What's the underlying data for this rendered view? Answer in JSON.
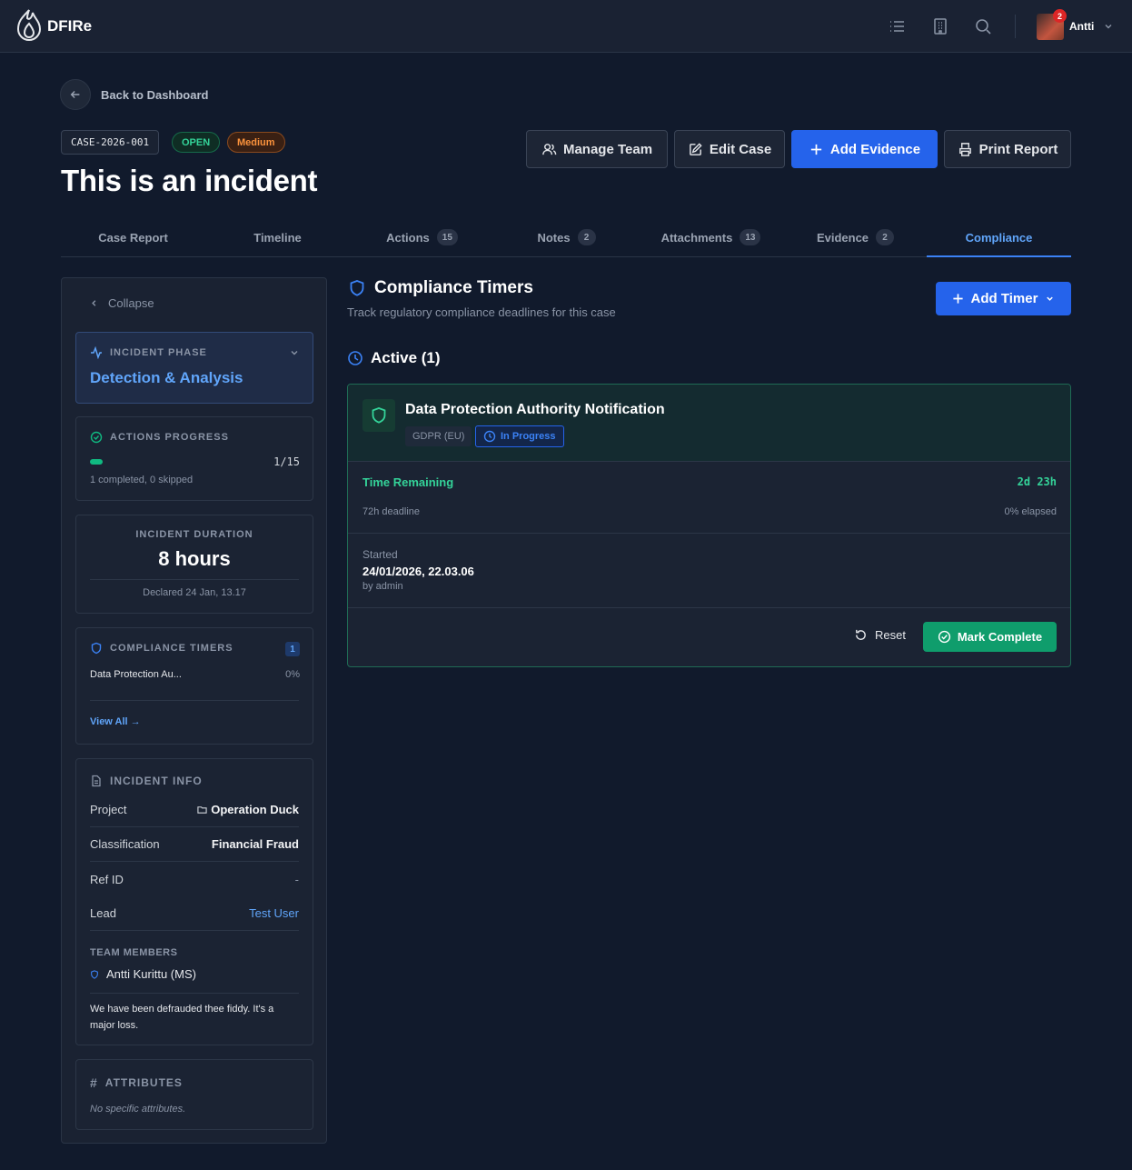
{
  "app": {
    "name": "DFIRe"
  },
  "user": {
    "name": "Antti",
    "notifications": "2"
  },
  "nav": {
    "back_label": "Back to Dashboard"
  },
  "case": {
    "id": "CASE-2026-001",
    "status": "OPEN",
    "severity": "Medium",
    "title": "This is an incident"
  },
  "header_buttons": {
    "manage_team": "Manage Team",
    "edit_case": "Edit Case",
    "add_evidence": "Add Evidence",
    "print_report": "Print Report"
  },
  "tabs": [
    {
      "label": "Case Report",
      "count": ""
    },
    {
      "label": "Timeline",
      "count": ""
    },
    {
      "label": "Actions",
      "count": "15"
    },
    {
      "label": "Notes",
      "count": "2"
    },
    {
      "label": "Attachments",
      "count": "13"
    },
    {
      "label": "Evidence",
      "count": "2"
    },
    {
      "label": "Compliance",
      "count": "",
      "active": true
    }
  ],
  "sidebar": {
    "collapse_label": "Collapse",
    "phase": {
      "label": "INCIDENT PHASE",
      "value": "Detection & Analysis"
    },
    "progress": {
      "label": "ACTIONS PROGRESS",
      "count": "1/15",
      "fraction": 0.0667,
      "sub": "1 completed, 0 skipped"
    },
    "duration": {
      "label": "INCIDENT DURATION",
      "value": "8 hours",
      "declared": "Declared 24 Jan, 13.17"
    },
    "compliance": {
      "label": "COMPLIANCE TIMERS",
      "count": "1",
      "item": "Data Protection Au...",
      "pct": "0%",
      "view_all": "View All →"
    },
    "info": {
      "label": "INCIDENT INFO",
      "rows": [
        {
          "key": "Project",
          "value": "Operation Duck"
        },
        {
          "key": "Classification",
          "value": "Financial Fraud"
        },
        {
          "key": "Ref ID",
          "value": "-"
        },
        {
          "key": "Lead",
          "value": "Test User"
        }
      ],
      "team_label": "TEAM MEMBERS",
      "team_member": "Antti Kurittu (MS)",
      "description": "We have been defrauded thee fiddy. It's a major loss."
    },
    "attributes": {
      "label": "ATTRIBUTES",
      "empty": "No specific attributes."
    }
  },
  "compliance": {
    "title": "Compliance Timers",
    "subtitle": "Track regulatory compliance deadlines for this case",
    "add_timer": "Add Timer",
    "active_label": "Active (1)",
    "timer": {
      "title": "Data Protection Authority Notification",
      "regulation": "GDPR (EU)",
      "status": "In Progress",
      "time_remaining_label": "Time Remaining",
      "time_remaining": "2d 23h",
      "deadline": "72h deadline",
      "elapsed": "0% elapsed",
      "started_label": "Started",
      "started": "24/01/2026, 22.03.06",
      "started_by": "by admin",
      "reset_label": "Reset",
      "complete_label": "Mark Complete"
    }
  },
  "colors": {
    "accent": "#2563eb",
    "success": "#10b981",
    "warning": "#fb923c",
    "background": "#111a2c"
  }
}
